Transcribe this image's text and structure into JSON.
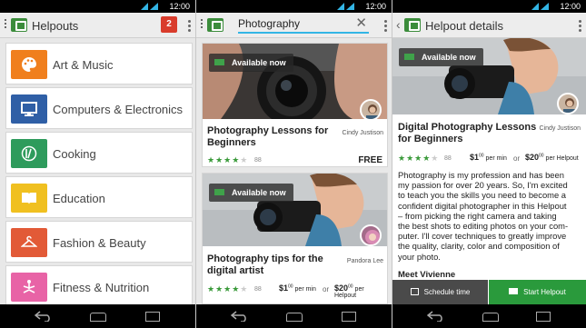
{
  "statusbar": {
    "time": "12:00"
  },
  "helpouts": {
    "title": "Helpouts",
    "badge": "2",
    "categories": [
      {
        "label": "Art & Music",
        "color": "#f07f1d",
        "icon": "palette-icon"
      },
      {
        "label": "Computers & Electronics",
        "color": "#2f5fa6",
        "icon": "monitor-icon"
      },
      {
        "label": "Cooking",
        "color": "#2e9b5c",
        "icon": "utensils-icon"
      },
      {
        "label": "Education",
        "color": "#f0c020",
        "icon": "book-icon"
      },
      {
        "label": "Fashion & Beauty",
        "color": "#e25a37",
        "icon": "hanger-icon"
      },
      {
        "label": "Fitness & Nutrition",
        "color": "#e863a6",
        "icon": "yoga-icon"
      }
    ]
  },
  "search": {
    "query": "Photography",
    "cards": [
      {
        "available": "Available now",
        "title_line1": "Photography Lessons for",
        "title_line2": "Beginners",
        "author": "Cindy Justison",
        "rating_count": "88",
        "price": "FREE"
      },
      {
        "available": "Available now",
        "title_line1": "Photography tips for the",
        "title_line2": "digital artist",
        "author": "Pandora Lee",
        "rating_count": "88",
        "price_min_dollars": "$1",
        "price_min_cents": "00",
        "price_min_unit": "per min",
        "or": "or",
        "price_helpout_dollars": "$20",
        "price_helpout_cents": "00",
        "price_helpout_unit": "per Helpout"
      }
    ]
  },
  "detail": {
    "title": "Helpout details",
    "available": "Available now",
    "course_line1": "Digital Photography Lessons",
    "course_line2": "for Beginners",
    "author": "Cindy Justison",
    "rating_count": "88",
    "price_min_dollars": "$1",
    "price_min_cents": "00",
    "price_min_unit": "per min",
    "or": "or",
    "price_helpout_dollars": "$20",
    "price_helpout_cents": "00",
    "price_helpout_unit": "per Helpout",
    "description": [
      "Photography is my profession and has been",
      "my passion for over 20 years. So, I'm excited",
      "to teach you the skills you need to become a",
      "confident digital photographer in this Helpout",
      "– from picking the right camera and taking",
      "the best shots to editing photos on your com-",
      "puter. I'll cover techniques to greatly improve",
      "the quality, clarity, color and composition of",
      "your photo."
    ],
    "meet": "Meet Vivienne",
    "schedule_label": "Schedule time",
    "start_label": "Start Helpout"
  },
  "colors": {
    "green": "#2a9a3c",
    "accent": "#33b5e5",
    "star": "#3a9a3a",
    "badge": "#d93c2c"
  }
}
